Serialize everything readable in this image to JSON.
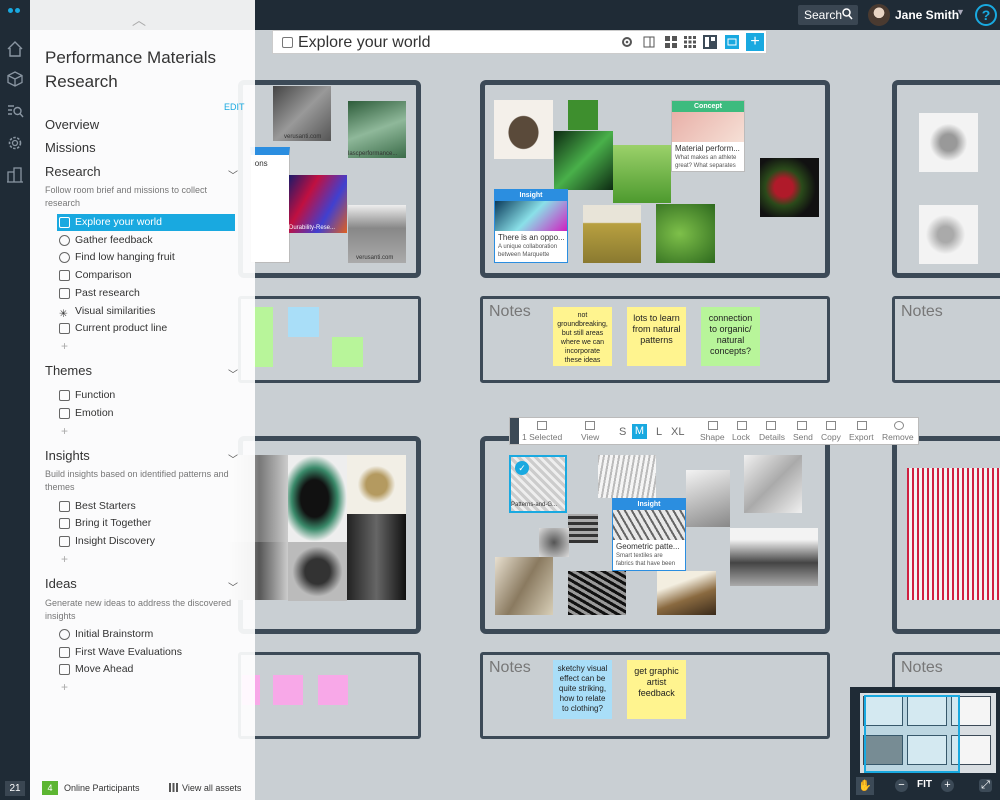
{
  "topbar": {
    "search_label": "Search",
    "user_name": "Jane Smith",
    "help_label": "?"
  },
  "rail": {
    "count": "21"
  },
  "panel": {
    "title": "Performance Materials Research",
    "edit_label": "EDIT",
    "nav": [
      "Overview",
      "Missions"
    ],
    "sections": [
      {
        "title": "Research",
        "desc": "Follow room brief and missions to collect research",
        "items": [
          "Explore your world",
          "Gather feedback",
          "Find low hanging fruit",
          "Comparison",
          "Past research",
          "Visual similarities",
          "Current product line"
        ]
      },
      {
        "title": "Themes",
        "desc": "",
        "items": [
          "Function",
          "Emotion"
        ]
      },
      {
        "title": "Insights",
        "desc": "Build insights based on identified patterns and themes",
        "items": [
          "Best Starters",
          "Bring it Together",
          "Insight Discovery"
        ]
      },
      {
        "title": "Ideas",
        "desc": "Generate new ideas to address the discovered insights",
        "items": [
          "Initial Brainstorm",
          "First Wave Evaluations",
          "Move Ahead"
        ]
      }
    ],
    "footer": {
      "online_count": "4",
      "online_label": "Online Participants",
      "assets_label": "View all assets"
    }
  },
  "room": {
    "title": "Explore your world"
  },
  "canvas": {
    "notes_label": "Notes",
    "board1_texts": {
      "site1": "verusanti.com",
      "site2": "lascperformance...",
      "site3": "Durability-Rese...",
      "site4": "verusanti.com",
      "missions": "ions"
    },
    "concept_card": {
      "header": "Concept",
      "title": "Material perform...",
      "desc": "What makes an athlete great? What separates"
    },
    "insight_card1": {
      "header": "Insight",
      "title": "There is an oppo...",
      "desc": "A unique collaboration between Marquette"
    },
    "insight_card2": {
      "header": "Insight",
      "title": "Geometric patte...",
      "desc": "Smart textiles are fabrics that have been"
    },
    "selected_file": "Patterns-and-G...",
    "stickies_top": [
      "not groundbreaking, but still areas where we can incorporate these ideas",
      "lots to learn from natural patterns",
      "connection to organic/ natural concepts?"
    ],
    "stickies_bottom": [
      "sketchy visual effect can be quite striking, how to relate to clothing?",
      "get graphic artist feedback"
    ]
  },
  "toolbar": {
    "selected": "1 Selected",
    "view": "View",
    "sizes": [
      "S",
      "M",
      "L",
      "XL"
    ],
    "actions": [
      "Shape",
      "Lock",
      "Details",
      "Send",
      "Copy",
      "Export",
      "Remove"
    ]
  },
  "minimap": {
    "fit_label": "FIT"
  },
  "colors": {
    "accent": "#19a9e0",
    "topbar": "#1f2b36",
    "board_border": "#3c4a57",
    "sticky_yellow": "#fff48f",
    "sticky_green": "#b8f59a",
    "sticky_blue": "#a9def8",
    "insight": "#2b8ee0",
    "concept": "#3dbb7e"
  }
}
